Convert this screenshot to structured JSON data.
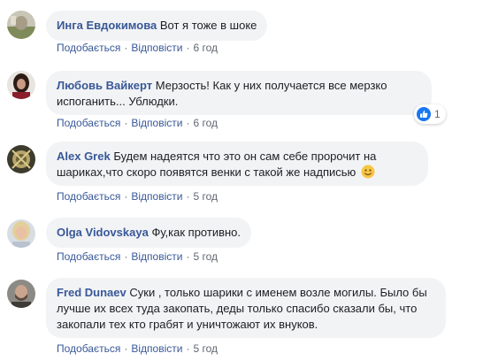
{
  "comments": [
    {
      "author": "Инга Евдокимова",
      "text": "Вот я тоже в шоке",
      "like_label": "Подобається",
      "reply_label": "Відповісти",
      "time": "6 год"
    },
    {
      "author": "Любовь Вайкерт",
      "text": "Мерзость! Как у них получается все мерзко испоганить... Ублюдки.",
      "like_label": "Подобається",
      "reply_label": "Відповісти",
      "time": "6 год",
      "reaction": {
        "icon": "like-icon",
        "count": "1",
        "color": "#1877f2"
      }
    },
    {
      "author": "Alex Grek",
      "text": "Будем надеятся что это он сам себе пророчит на шариках,что скоро появятся венки с такой же надписью",
      "emoji": "smiling-face-emoji",
      "like_label": "Подобається",
      "reply_label": "Відповісти",
      "time": "5 год"
    },
    {
      "author": "Olga Vidovskaya",
      "text": "Фу,как противно.",
      "like_label": "Подобається",
      "reply_label": "Відповісти",
      "time": "5 год"
    },
    {
      "author": "Fred Dunaev",
      "text": "Суки , только шарики с именем возле могилы. Было бы лучше их всех туда закопать, деды только спасибо сказали бы, что закопали тех кто грабят и уничтожают их внуков.",
      "like_label": "Подобається",
      "reply_label": "Відповісти",
      "time": "5 год"
    }
  ],
  "colors": {
    "author": "#385898",
    "bubble": "#f2f3f5",
    "meta": "#606770"
  }
}
